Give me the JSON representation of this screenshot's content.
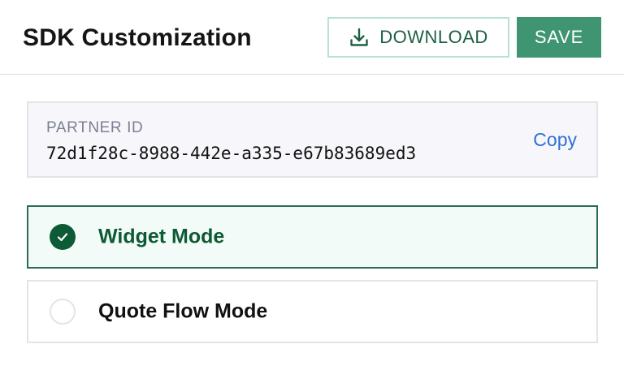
{
  "header": {
    "title": "SDK Customization",
    "download_label": "DOWNLOAD",
    "save_label": "SAVE"
  },
  "partner": {
    "label": "PARTNER ID",
    "value": "72d1f28c-8988-442e-a335-e67b83689ed3",
    "copy_label": "Copy"
  },
  "modes": [
    {
      "label": "Widget Mode",
      "selected": true
    },
    {
      "label": "Quote Flow Mode",
      "selected": false
    }
  ],
  "colors": {
    "accent": "#3f9571",
    "selected_text": "#0e5a33",
    "link": "#2f6fd6"
  },
  "icons": {
    "download": "download-icon",
    "check": "check-icon"
  }
}
